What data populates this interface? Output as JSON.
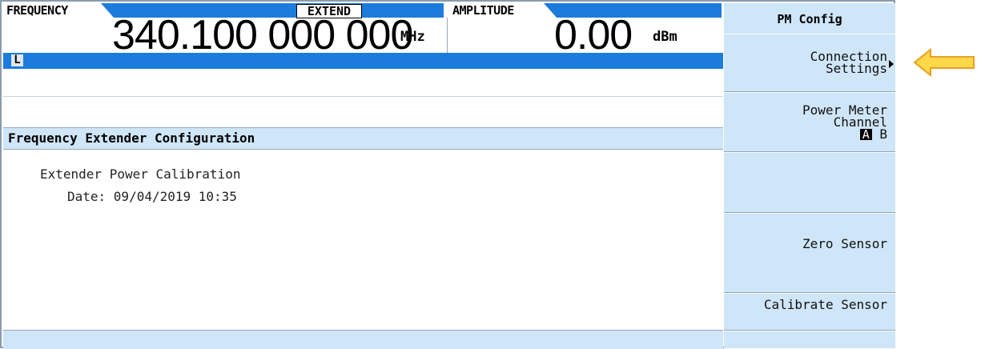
{
  "header": {
    "frequency_label": "FREQUENCY",
    "extend_badge": "EXTEND",
    "frequency_value": "340.100 000 000",
    "frequency_unit": "MHz",
    "amplitude_label": "AMPLITUDE",
    "amplitude_value": "0.00",
    "amplitude_unit": "dBm",
    "status_indicator": "L"
  },
  "main": {
    "section_title": "Frequency Extender Configuration",
    "line1": "Extender Power Calibration",
    "line2": "Date: 09/04/2019 10:35"
  },
  "softkeys": {
    "title": "PM Config",
    "connection_line1": "Connection",
    "connection_line2": "Settings",
    "power_meter_line1": "Power Meter",
    "power_meter_line2": "Channel",
    "channel_a": "A",
    "channel_b": "B",
    "zero_sensor": "Zero Sensor",
    "calibrate_sensor": "Calibrate Sensor"
  },
  "colors": {
    "header_blue": "#1c7cdc",
    "panel_light_blue": "#cfe5f8",
    "callout_yellow": "#ffd84a",
    "callout_orange": "#e8a020"
  }
}
